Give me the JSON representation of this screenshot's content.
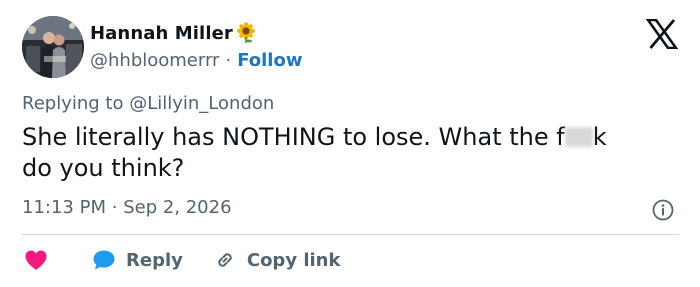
{
  "author": {
    "display_name": "Hannah Miller",
    "emoji": "sunflower-icon",
    "handle": "@hhbloomerrr",
    "separator": "·",
    "follow_label": "Follow"
  },
  "reply_to": {
    "prefix": "Replying to",
    "handle": "@Lillyin_London"
  },
  "tweet": {
    "text_part1": "She literally has NOTHING to lose. What the f",
    "text_part2": "k",
    "text_line2": "do you think?"
  },
  "meta": {
    "time": "11:13 PM",
    "separator": "·",
    "date": "Sep 2, 2026"
  },
  "actions": {
    "reply_label": "Reply",
    "copy_label": "Copy link"
  },
  "colors": {
    "link_blue": "#1d75c4",
    "heart": "#f91880",
    "reply_bubble": "#1d9bf0",
    "muted": "#536471"
  }
}
